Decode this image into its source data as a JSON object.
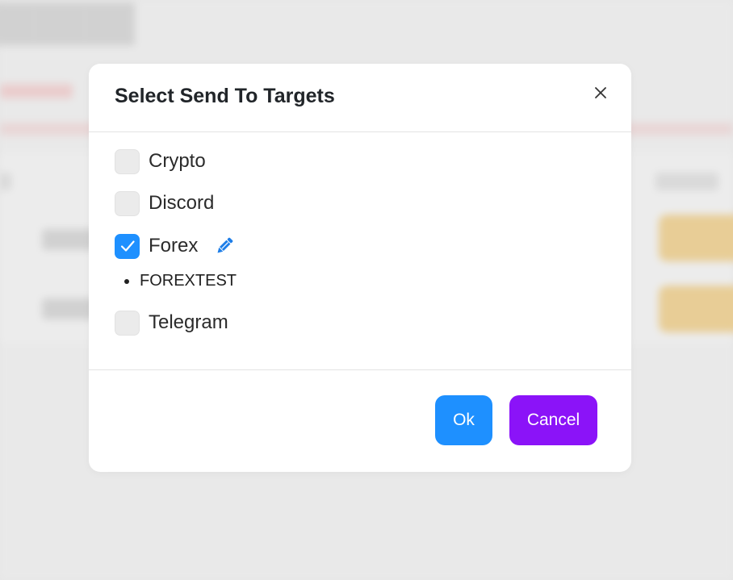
{
  "colors": {
    "primary": "#1e90ff",
    "cancel": "#8b13f8",
    "checkbox_unchecked": "#ebebeb"
  },
  "modal": {
    "title": "Select Send To Targets",
    "close_icon": "close-icon",
    "targets": [
      {
        "label": "Crypto",
        "checked": false
      },
      {
        "label": "Discord",
        "checked": false
      },
      {
        "label": "Forex",
        "checked": true,
        "edit_icon": "pencil-icon",
        "sub_items": [
          "FOREXTEST"
        ]
      },
      {
        "label": "Telegram",
        "checked": false
      }
    ],
    "ok_label": "Ok",
    "cancel_label": "Cancel"
  }
}
